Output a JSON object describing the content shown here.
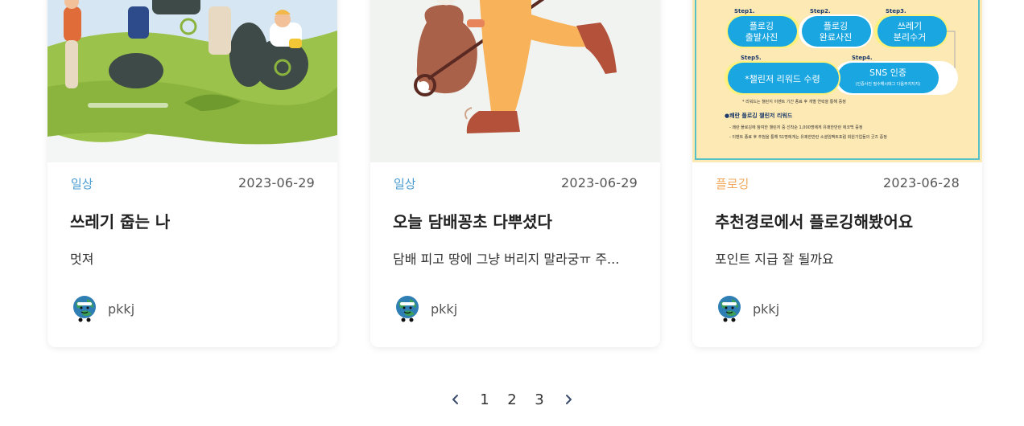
{
  "colors": {
    "category_daily": "#4a9bd1",
    "category_plogging": "#f2a85a",
    "text_dark": "#222222",
    "text_muted": "#555555"
  },
  "posts": [
    {
      "category": "일상",
      "category_color": "#4a9bd1",
      "date": "2023-06-29",
      "title": "쓰레기 줍는 나",
      "description": "멋져",
      "author": "pkkj",
      "thumbnail_icon": "people-picking-trash-illustration"
    },
    {
      "category": "일상",
      "category_color": "#4a9bd1",
      "date": "2023-06-29",
      "title": "오늘 담배꽁초 다뿌셨다",
      "description": "담배 피고 땅에 그냥 버리지 말라궁ㅠ 주...",
      "author": "pkkj",
      "thumbnail_icon": "trash-picker-illustration"
    },
    {
      "category": "플로깅",
      "category_color": "#f2a85a",
      "date": "2023-06-28",
      "title": "추천경로에서 플로깅해봤어요",
      "description": "포인트 지급 잘 될까요",
      "author": "pkkj",
      "thumbnail_icon": "plogging-challenge-poster"
    }
  ],
  "poster": {
    "steps": [
      {
        "label": "Step1.",
        "text1": "플로깅",
        "text2": "출발사진"
      },
      {
        "label": "Step2.",
        "text1": "플로깅",
        "text2": "완료사진"
      },
      {
        "label": "Step3.",
        "text1": "쓰레기",
        "text2": "분리수거"
      },
      {
        "label": "Step4.",
        "text1": "SNS 인증",
        "text2": "(인증사진 필수해시태그 다음주지지지)"
      },
      {
        "label": "Step5.",
        "text1": "*챌린저 리워드 수령",
        "text2": ""
      }
    ],
    "footnote": "* 리워드는 챌린지 이벤트 기간 종료 후 개별 연락을 통해 증정",
    "reward_title": "●쾌란 플로깅 챌린저 리워드",
    "reward_line1": "- 쾌란 플로깅에 참여한 챌린저 중 선착순 1,000명에게 유쾌한반란 에코백 증정",
    "reward_line2": "- 이벤트 종료 후 추첨을 통해 51명에게는 유쾌한반란 소셜임팩트포럼 회원기업들의 굿즈 증정"
  },
  "pagination": {
    "prev_icon": "chevron-left-icon",
    "next_icon": "chevron-right-icon",
    "pages": [
      "1",
      "2",
      "3"
    ]
  }
}
